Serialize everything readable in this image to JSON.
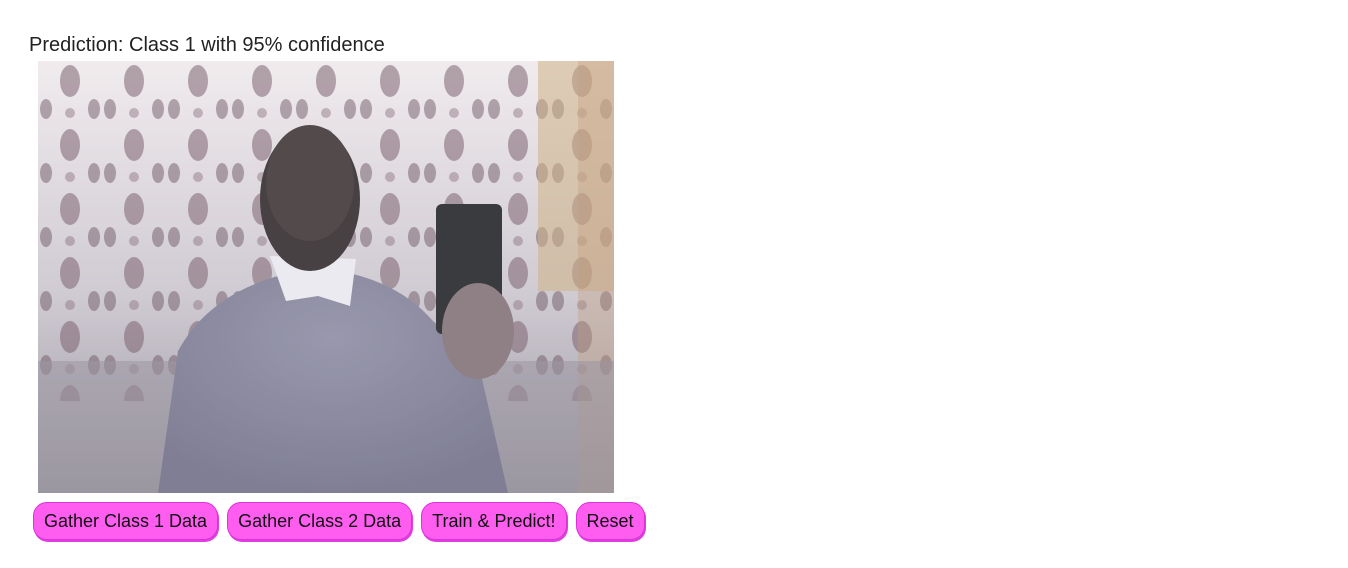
{
  "status": {
    "prediction_text": "Prediction: Class 1 with 95% confidence"
  },
  "webcam": {
    "icon": "webcam-video-feed"
  },
  "buttons": {
    "gather_class_1": "Gather Class 1 Data",
    "gather_class_2": "Gather Class 2 Data",
    "train_predict": "Train & Predict!",
    "reset": "Reset"
  },
  "colors": {
    "button_bg": "#ff5cf0",
    "button_border": "#d636d6",
    "text": "#222222"
  }
}
